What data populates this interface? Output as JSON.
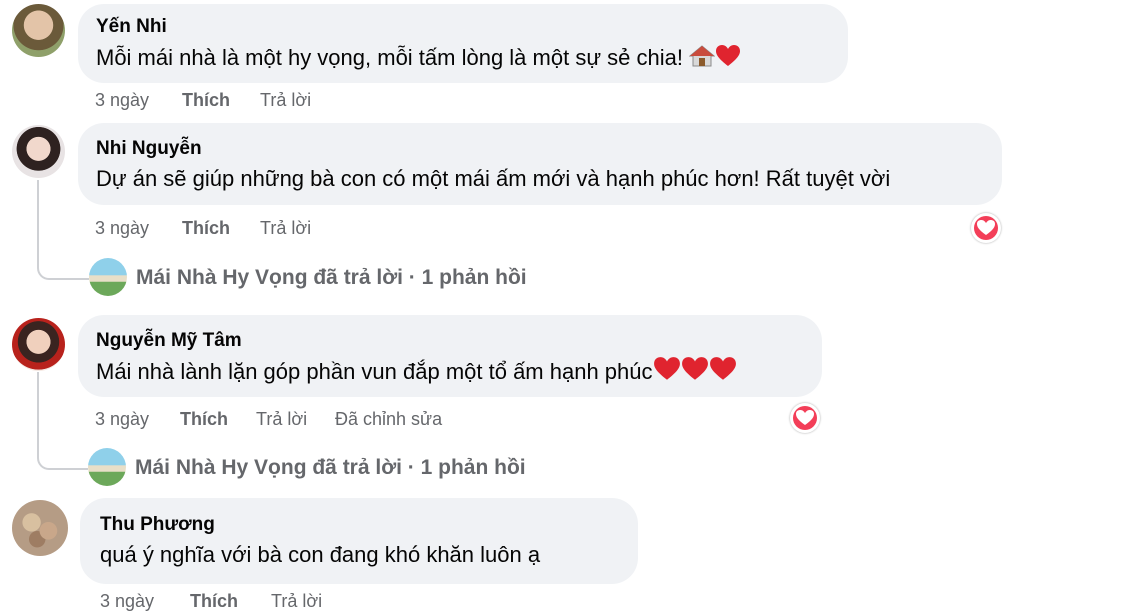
{
  "comments": [
    {
      "author": "Yến Nhi",
      "text": "Mỗi mái nhà là một hy vọng, mỗi tấm lòng là một sự sẻ chia!",
      "time": "3 ngày",
      "like": "Thích",
      "reply": "Trả lời"
    },
    {
      "author": "Nhi Nguyễn",
      "text": "Dự án sẽ giúp những bà con có một mái ấm mới và hạnh phúc hơn! Rất tuyệt vời",
      "time": "3 ngày",
      "like": "Thích",
      "reply": "Trả lời",
      "replies_summary": "Mái Nhà Hy Vọng đã trả lời · 1 phản hồi"
    },
    {
      "author": "Nguyễn Mỹ Tâm",
      "text": "Mái nhà lành lặn góp phần vun đắp một tổ ấm hạnh phúc",
      "time": "3 ngày",
      "like": "Thích",
      "reply": "Trả lời",
      "edited": "Đã chỉnh sửa",
      "replies_summary": "Mái Nhà Hy Vọng đã trả lời · 1 phản hồi"
    },
    {
      "author": "Thu Phương",
      "text": "quá ý nghĩa với bà con đang khó khăn luôn ạ",
      "time": "3 ngày",
      "like": "Thích",
      "reply": "Trả lời"
    }
  ],
  "icons": {
    "house": "house-emoji-icon",
    "heart": "red-heart-emoji-icon",
    "reaction": "love-reaction-icon"
  },
  "colors": {
    "bubble": "#f0f2f5",
    "meta": "#65676b",
    "love": "#f33e58",
    "heart": "#e0242f"
  }
}
